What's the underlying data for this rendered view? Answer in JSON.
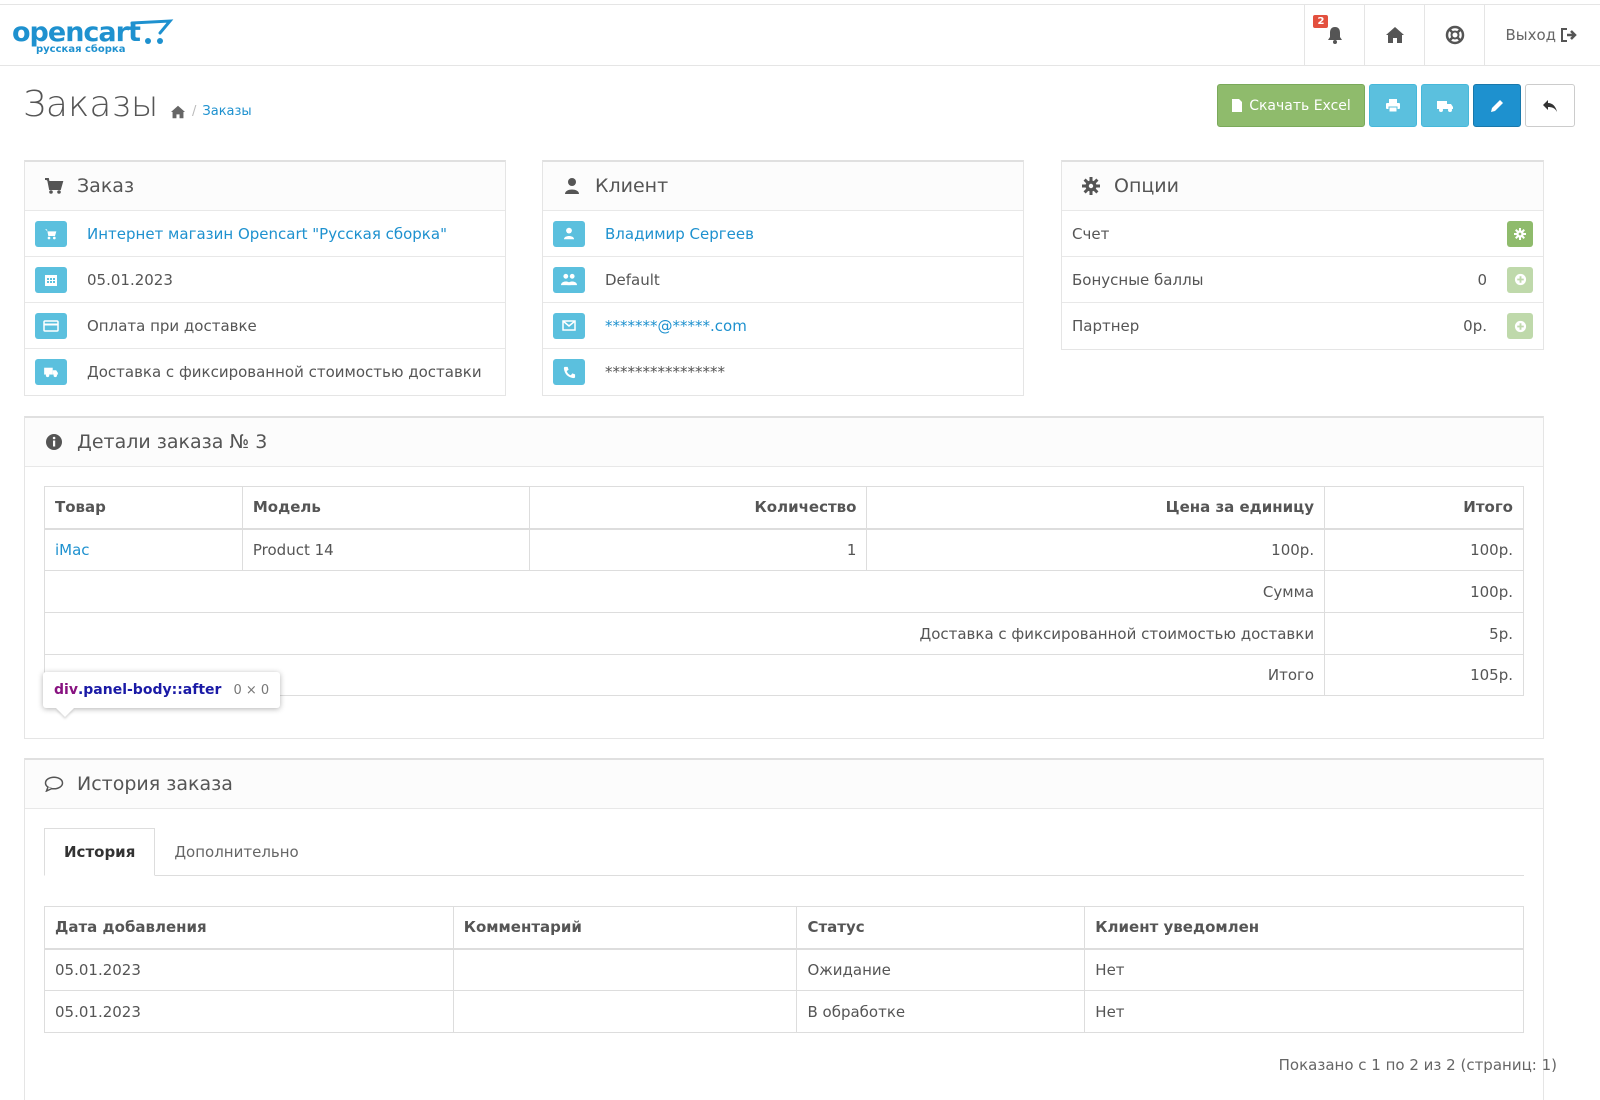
{
  "header": {
    "logo_main": "opencart",
    "logo_sub": "русская сборка",
    "notification_count": "2",
    "logout_label": "Выход"
  },
  "page": {
    "title": "Заказы",
    "breadcrumb": {
      "separator": "/",
      "current": "Заказы"
    },
    "actions": {
      "excel_label": "Скачать Excel"
    }
  },
  "order_panel": {
    "title": "Заказ",
    "store": "Интернет магазин Opencart \"Русская сборка\"",
    "date": "05.01.2023",
    "payment": "Оплата при доставке",
    "shipping": "Доставка с фиксированной стоимостью доставки"
  },
  "customer_panel": {
    "title": "Клиент",
    "name": "Владимир Сергеев",
    "group": "Default",
    "email": "*******@*****.com",
    "phone": "****************"
  },
  "options_panel": {
    "title": "Опции",
    "invoice_label": "Счет",
    "reward_label": "Бонусные баллы",
    "reward_value": "0",
    "affiliate_label": "Партнер",
    "affiliate_value": "0р."
  },
  "details_panel": {
    "title": "Детали заказа № 3",
    "columns": [
      "Товар",
      "Модель",
      "Количество",
      "Цена за единицу",
      "Итого"
    ],
    "products": [
      {
        "name": "iMac",
        "model": "Product 14",
        "quantity": "1",
        "price": "100р.",
        "total": "100р."
      }
    ],
    "totals": [
      {
        "label": "Сумма",
        "value": "100р."
      },
      {
        "label": "Доставка с фиксированной стоимостью доставки",
        "value": "5р."
      },
      {
        "label": "Итого",
        "value": "105р."
      }
    ]
  },
  "tooltip": {
    "tag": "div",
    "cls": ".panel-body::after",
    "dims": "0 × 0"
  },
  "history_panel": {
    "title": "История заказа",
    "tabs": [
      "История",
      "Дополнительно"
    ],
    "columns": [
      "Дата добавления",
      "Комментарий",
      "Статус",
      "Клиент уведомлен"
    ],
    "rows": [
      {
        "date": "05.01.2023",
        "comment": "",
        "status": "Ожидание",
        "notified": "Нет"
      },
      {
        "date": "05.01.2023",
        "comment": "",
        "status": "В обработке",
        "notified": "Нет"
      }
    ],
    "pagination_text": "Показано с 1 по 2 из 2 (страниц: 1)"
  },
  "colors": {
    "primary": "#1e91cf",
    "info": "#5bc0de",
    "success": "#8fbb6c",
    "badge": "#e3503e"
  }
}
